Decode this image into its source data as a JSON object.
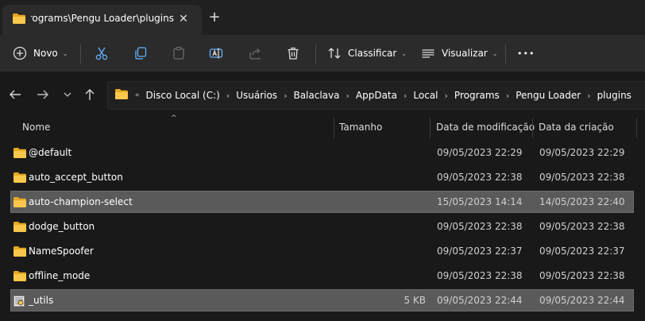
{
  "window": {
    "tab_title": "Programs\\Pengu Loader\\plugins",
    "tab_close": "✕",
    "new_tab": "+"
  },
  "toolbar": {
    "new_label": "Novo",
    "sort_label": "Classificar",
    "view_label": "Visualizar",
    "more_label": "•••",
    "chevron": "⌄"
  },
  "address": {
    "overflow": "«",
    "separator": "›",
    "crumbs": [
      "Disco Local (C:)",
      "Usuários",
      "Balaclava",
      "AppData",
      "Local",
      "Programs",
      "Pengu Loader",
      "plugins"
    ]
  },
  "columns": {
    "name": "Nome",
    "size": "Tamanho",
    "modified": "Data de modificação",
    "created": "Data da criação",
    "sort_caret": "^"
  },
  "rows": [
    {
      "name": "@default",
      "size": "",
      "modified": "09/05/2023 22:29",
      "created": "09/05/2023 22:29",
      "type": "folder",
      "selected": false
    },
    {
      "name": "auto_accept_button",
      "size": "",
      "modified": "09/05/2023 22:38",
      "created": "09/05/2023 22:38",
      "type": "folder",
      "selected": false
    },
    {
      "name": "auto-champion-select",
      "size": "",
      "modified": "15/05/2023 14:14",
      "created": "14/05/2023 22:40",
      "type": "folder",
      "selected": true
    },
    {
      "name": "dodge_button",
      "size": "",
      "modified": "09/05/2023 22:38",
      "created": "09/05/2023 22:38",
      "type": "folder",
      "selected": false
    },
    {
      "name": "NameSpoofer",
      "size": "",
      "modified": "09/05/2023 22:37",
      "created": "09/05/2023 22:37",
      "type": "folder",
      "selected": false
    },
    {
      "name": "offline_mode",
      "size": "",
      "modified": "09/05/2023 22:38",
      "created": "09/05/2023 22:38",
      "type": "folder",
      "selected": false
    },
    {
      "name": "_utils",
      "size": "5 KB",
      "modified": "09/05/2023 22:44",
      "created": "09/05/2023 22:44",
      "type": "file",
      "selected": true
    }
  ],
  "colors": {
    "folder": "#f8c74b",
    "folder_dark": "#e5a823",
    "selected_row": "#5a5a5a",
    "toolbar_bg": "#2b2b2b",
    "content_bg": "#191919"
  }
}
